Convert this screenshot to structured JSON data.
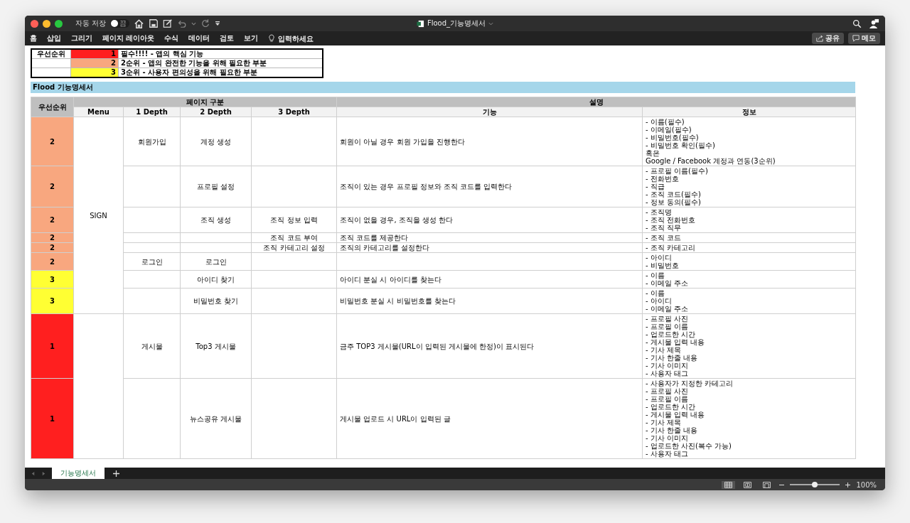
{
  "window": {
    "title": "Flood_기능명세서",
    "autosave": {
      "label": "자동 저장",
      "state": "끔",
      "on": false
    }
  },
  "ribbon": {
    "tabs": [
      "홈",
      "삽입",
      "그리기",
      "페이지 레이아웃",
      "수식",
      "데이터",
      "검토",
      "보기"
    ],
    "search": {
      "placeholder": "입력하세요"
    },
    "buttons": [
      {
        "kind": "share",
        "label": "공유"
      },
      {
        "kind": "memo",
        "label": "메모"
      }
    ]
  },
  "legend": {
    "title": "우선순위",
    "levels": [
      {
        "number": "1",
        "color": "#ff1f1f",
        "description": "필수!!!! - 앱의 핵심 기능"
      },
      {
        "number": "2",
        "color": "#f8a77f",
        "description": "2순위 - 앱의 완전한 기능을 위해 필요한 부분"
      },
      {
        "number": "3",
        "color": "#ffff33",
        "description": "3순위 - 사용자 편의성을 위해 필요한 부분"
      }
    ]
  },
  "banner": "Flood 기능명세서",
  "table": {
    "priority_header": "우선순위",
    "group_headers": [
      "페이지 구분",
      "설명"
    ],
    "columns": [
      "Menu",
      "1 Depth",
      "2 Depth",
      "3 Depth",
      "기능",
      "정보"
    ],
    "groups": [
      {
        "menu": "SIGN",
        "rows": [
          {
            "priority": "2",
            "color": "#f8a77f",
            "depth1": "회원가입",
            "depth2": "계정 생성",
            "function": "회원이 아닐 경우 회원 가입을 진행한다",
            "info": [
              "- 이름(필수)",
              "- 이메일(필수)",
              "- 비밀번호(필수)",
              "- 비밀번호 확인(필수)",
              "혹은",
              "Google / Facebook 계정과 연동(3순위)"
            ]
          },
          {
            "priority": "2",
            "color": "#f8a77f",
            "depth2": "프로필 설정",
            "function": "조직이 있는 경우 프로필 정보와 조직 코드를 입력한다",
            "info": [
              "- 프로필 이름(필수)",
              "- 전화번호",
              "- 직급",
              "- 조직 코드(필수)",
              "- 정보 동의(필수)"
            ]
          },
          {
            "priority": "2",
            "color": "#f8a77f",
            "depth2": "조직 생성",
            "depth3": "조직 정보 입력",
            "function": "조직이 없을 경우, 조직을 생성 한다",
            "info": [
              "- 조직명",
              "- 조직 전화번호",
              "- 조직 직무"
            ]
          },
          {
            "priority": "2",
            "color": "#f8a77f",
            "depth3": "조직 코드 부여",
            "function": "조직 코드를 제공한다",
            "info": [
              "- 조직 코드"
            ]
          },
          {
            "priority": "2",
            "color": "#f8a77f",
            "depth3": "조직 카테고리 설정",
            "function": "조직의 카테고리를 설정한다",
            "info": [
              "- 조직 카테고리"
            ]
          },
          {
            "priority": "2",
            "color": "#f8a77f",
            "depth1": "로그인",
            "depth2": "로그인",
            "info": [
              "- 아이디",
              "- 비밀번호"
            ]
          },
          {
            "priority": "3",
            "color": "#ffff33",
            "depth2": "아이디 찾기",
            "function": "아이디 분실 시 아이디를 찾는다",
            "info": [
              "- 이름",
              "- 이메일 주소"
            ]
          },
          {
            "priority": "3",
            "color": "#ffff33",
            "depth2": "비밀번호 찾기",
            "function": "비밀번호 분실 시 비밀번호를 찾는다",
            "info": [
              "- 이름",
              "- 아이디",
              "- 이메일 주소"
            ]
          }
        ]
      },
      {
        "rows": [
          {
            "priority": "1",
            "color": "#ff1f1f",
            "depth1": "게시물",
            "depth2": "Top3 게시물",
            "function": "금주 TOP3 게시물(URL이 입력된 게시물에 한정)이 표시된다",
            "info": [
              "- 프로필 사진",
              "- 프로필 이름",
              "- 업로드한 시간",
              "- 게시물 입력 내용",
              "- 기사 제목",
              "- 기사 한줄 내용",
              "- 기사 이미지",
              "- 사용자 태그"
            ]
          },
          {
            "priority": "1",
            "color": "#ff1f1f",
            "depth2": "뉴스공유 게시물",
            "function": "게시물 업로드 시 URL이 입력된 글",
            "info": [
              "- 사용자가 지정한 카테고리",
              "- 프로필 사진",
              "- 프로필 이름",
              "- 업로드한 시간",
              "- 게시물 입력 내용",
              "- 기사 제목",
              "- 기사 한줄 내용",
              "- 기사 이미지",
              "- 업로드한 사진(복수 가능)",
              "- 사용자 태그"
            ]
          }
        ]
      }
    ]
  },
  "sheet_tabs": [
    {
      "label": "기능명세서",
      "selected": true
    }
  ],
  "status_bar": {
    "views": [
      {
        "kind": "normal",
        "selected": true
      },
      {
        "kind": "page-layout",
        "selected": false
      },
      {
        "kind": "page-break",
        "selected": false
      }
    ],
    "zoom": {
      "level": 0.5,
      "reading": "100%"
    }
  }
}
